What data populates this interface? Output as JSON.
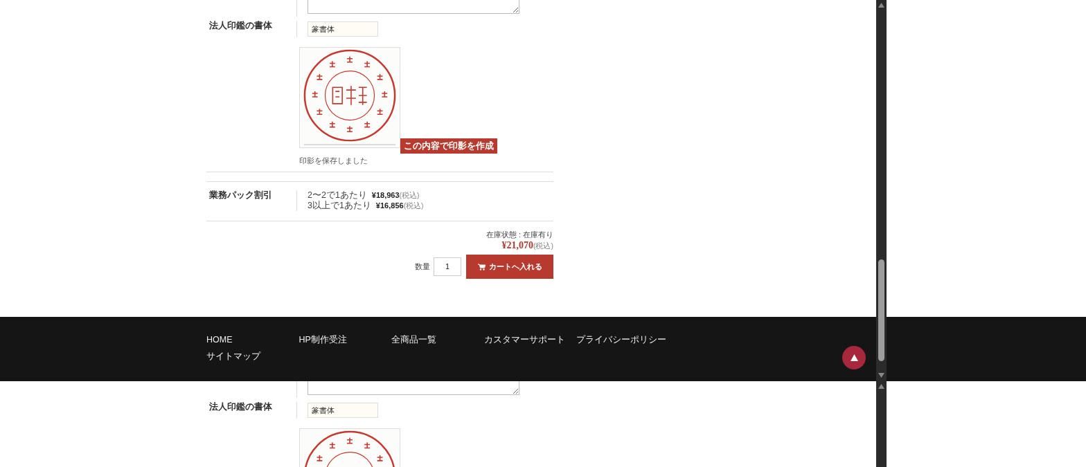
{
  "upper_view": {
    "font_row": {
      "label": "法人印鑑の書体",
      "value": "篆書体"
    },
    "create_button": "この内容で印影を作成",
    "saved_message": "印影を保存しました",
    "discount": {
      "label": "業務パック割引",
      "tiers": [
        {
          "condition": "2〜2で1あたり",
          "price": "¥18,963",
          "tax_note": "(税込)"
        },
        {
          "condition": "3以上で1あたり",
          "price": "¥16,856",
          "tax_note": "(税込)"
        }
      ]
    },
    "stock_status": "在庫状態 : 在庫有り",
    "price": "¥21,070",
    "price_tax_note": "(税込)",
    "quantity": {
      "label": "数量",
      "value": "1"
    },
    "cart_button": "カートへ入れる"
  },
  "footer": {
    "links": [
      "HOME",
      "HP制作受注",
      "全商品一覧",
      "カスタマーサポート",
      "プライバシーポリシー",
      "サイトマップ"
    ]
  },
  "lower_view": {
    "font_row": {
      "label": "法人印鑑の書体",
      "value": "篆書体"
    }
  }
}
